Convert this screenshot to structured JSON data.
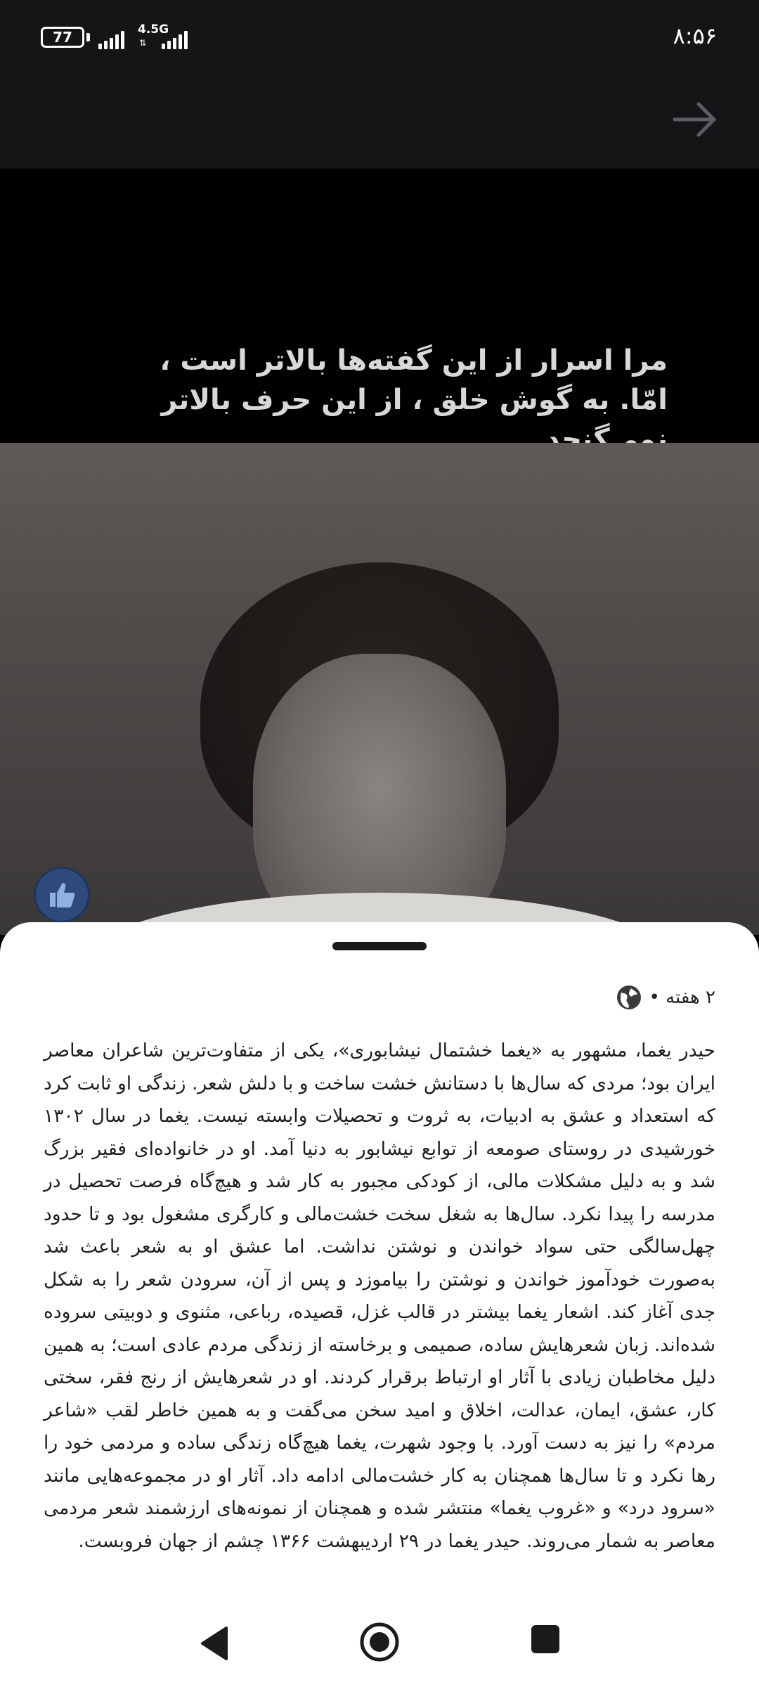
{
  "status_bar": {
    "battery": "77",
    "network": "4.5G",
    "time": "۸:۵۶"
  },
  "video": {
    "caption_line1": "مرا اسرار از این گفته‌ها بالاتر است ،",
    "caption_line2": "امّا. به گوش خلق ، از این حرف بالاتر نمی‌گنجد"
  },
  "post": {
    "age": "۲ هفته •",
    "description": "حیدر یغما، مشهور به «یغما خشتمال نیشابوری»، یکی از متفاوت‌ترین شاعران معاصر ایران بود؛ مردی که سال‌ها با دستانش خشت ساخت و با دلش شعر. زندگی او ثابت کرد که استعداد و عشق به ادبیات، به ثروت و تحصیلات وابسته نیست. یغما در سال ۱۳۰۲ خورشیدی در روستای صومعه از توابع نیشابور به دنیا آمد. او در خانواده‌ای فقیر بزرگ شد و به دلیل مشکلات مالی، از کودکی مجبور به کار شد و هیچ‌گاه فرصت تحصیل در مدرسه را پیدا نکرد. سال‌ها به شغل سخت خشت‌مالی و کارگری مشغول بود و تا حدود چهل‌سالگی حتی سواد خواندن و نوشتن نداشت. اما عشق او به شعر باعث شد به‌صورت خودآموز خواندن و نوشتن را بیاموزد و پس از آن، سرودن شعر را به شکل جدی آغاز کند. اشعار یغما بیشتر در قالب غزل، قصیده، رباعی، مثنوی و دوبیتی سروده شده‌اند. زبان شعرهایش ساده، صمیمی و برخاسته از زندگی مردم عادی است؛ به همین دلیل مخاطبان زیادی با آثار او ارتباط برقرار کردند. او در شعرهایش از رنج فقر، سختی کار، عشق، ایمان، عدالت، اخلاق و امید سخن می‌گفت و به همین خاطر لقب «شاعر مردم» را نیز به دست آورد. با وجود شهرت، یغما هیچ‌گاه زندگی ساده و مردمی خود را رها نکرد و تا سال‌ها همچنان به کار خشت‌مالی ادامه داد. آثار او در مجموعه‌هایی مانند «سرود درد» و «غروب یغما» منتشر شده و همچنان از نمونه‌های ارزشمند شعر مردمی معاصر به شمار می‌روند. حیدر یغما در ۲۹ اردیبهشت ۱۳۶۶ چشم از جهان فروبست."
  },
  "icons": {
    "forward": "arrow-right-icon",
    "like": "thumbs-up-icon",
    "globe": "globe-icon",
    "nav_back": "triangle-back-icon",
    "nav_home": "circle-home-icon",
    "nav_recents": "square-recents-icon"
  },
  "colors": {
    "bar_background": "#141517",
    "sheet_background": "#ffffff",
    "like_button": "#2e4a7a"
  }
}
